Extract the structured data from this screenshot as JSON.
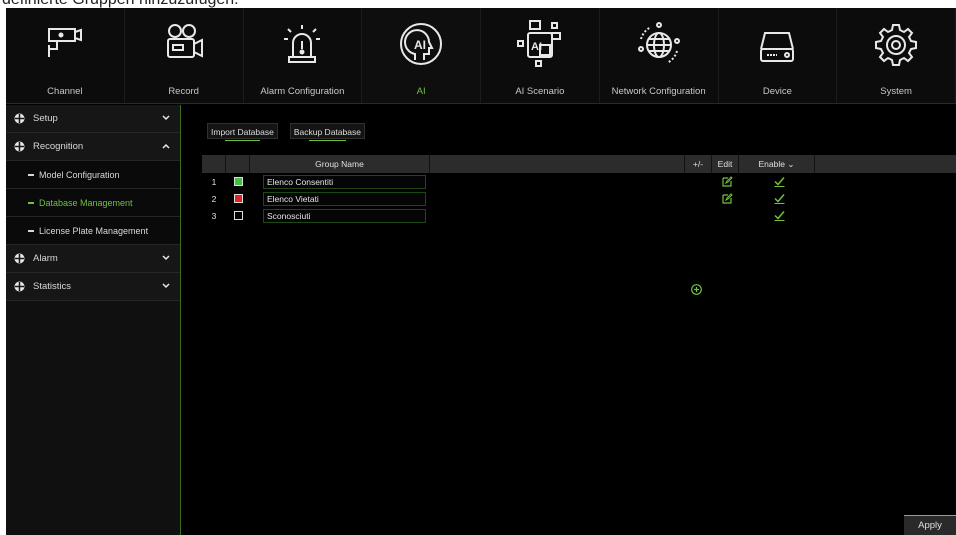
{
  "caption": "definierte Gruppen hinzuzufügen.",
  "topnav": {
    "items": [
      {
        "label": "Channel",
        "icon": "camera-icon"
      },
      {
        "label": "Record",
        "icon": "video-camera-icon"
      },
      {
        "label": "Alarm Configuration",
        "icon": "alarm-light-icon"
      },
      {
        "label": "AI",
        "icon": "ai-head-icon"
      },
      {
        "label": "AI Scenario",
        "icon": "ai-scenario-icon"
      },
      {
        "label": "Network Configuration",
        "icon": "globe-network-icon"
      },
      {
        "label": "Device",
        "icon": "hard-drive-icon"
      },
      {
        "label": "System",
        "icon": "gear-icon"
      }
    ],
    "active": "AI"
  },
  "sidebar": {
    "setup": "Setup",
    "recognition": "Recognition",
    "model_configuration": "Model Configuration",
    "database_management": "Database Management",
    "license_plate_management": "License Plate Management",
    "alarm": "Alarm",
    "statistics": "Statistics"
  },
  "toolbar": {
    "import_label": "Import Database",
    "backup_label": "Backup Database"
  },
  "table": {
    "headers": {
      "group_name": "Group Name",
      "plus_minus": "+/-",
      "edit": "Edit",
      "enable": "Enable"
    },
    "rows": [
      {
        "num": "1",
        "color": "#3bc43b",
        "name": "Elenco Consentiti",
        "editable": true,
        "enabled": true
      },
      {
        "num": "2",
        "color": "#e02424",
        "name": "Elenco Vietati",
        "editable": true,
        "enabled": true
      },
      {
        "num": "3",
        "color": "#000000",
        "name": "Sconosciuti",
        "editable": false,
        "enabled": true
      }
    ]
  },
  "apply_label": "Apply",
  "colors": {
    "accent": "#6fc23e",
    "background": "#000000"
  }
}
